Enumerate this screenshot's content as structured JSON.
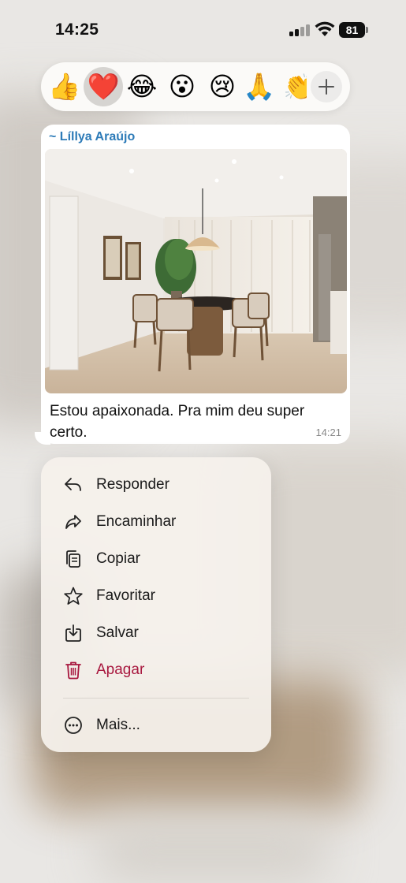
{
  "status_bar": {
    "time": "14:25",
    "battery": "81"
  },
  "reactions": [
    {
      "emoji": "👍",
      "name": "thumbs-up"
    },
    {
      "emoji": "❤️",
      "name": "heart",
      "selected": true
    },
    {
      "emoji": "😂",
      "name": "laughing"
    },
    {
      "emoji": "😮",
      "name": "surprised"
    },
    {
      "emoji": "😢",
      "name": "crying"
    },
    {
      "emoji": "🙏",
      "name": "praying-hands"
    },
    {
      "emoji": "👏",
      "name": "clapping"
    }
  ],
  "message": {
    "sender": "~ Líllya Araújo",
    "text": "Estou apaixonada. Pra mim deu super certo.",
    "time": "14:21"
  },
  "menu": {
    "reply": "Responder",
    "forward": "Encaminhar",
    "copy": "Copiar",
    "favorite": "Favoritar",
    "save": "Salvar",
    "delete": "Apagar",
    "more": "Mais..."
  },
  "colors": {
    "sender": "#2d7bb8",
    "danger": "#a8183f",
    "bubble": "#ffffff",
    "menu": "#f5f1ec"
  }
}
